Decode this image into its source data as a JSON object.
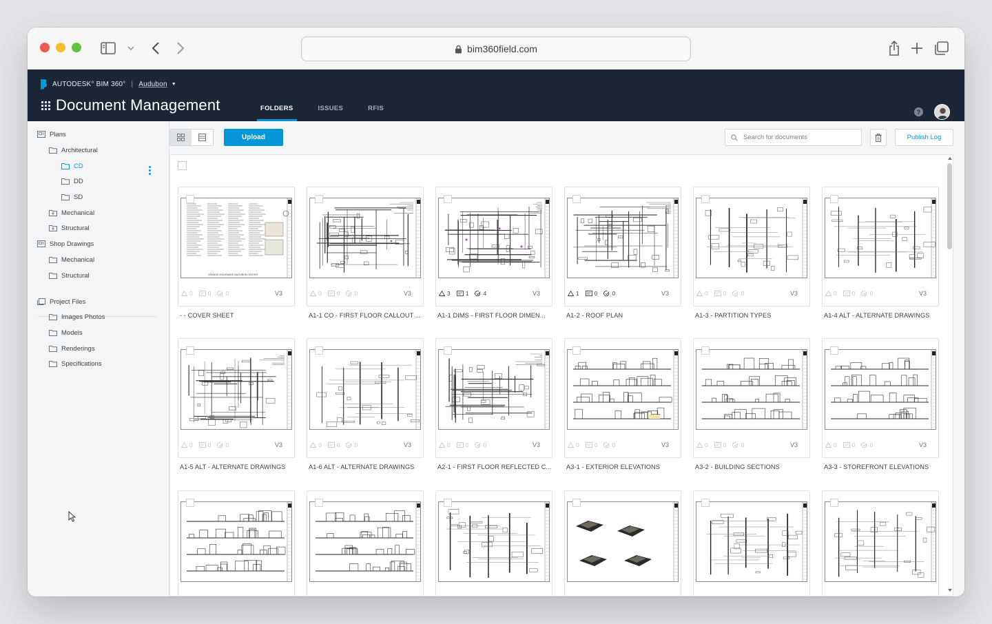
{
  "browser": {
    "url": "bim360field.com"
  },
  "header": {
    "brand": "AUTODESK° BIM 360°",
    "project": "Audubon",
    "title": "Document Management",
    "tabs": [
      {
        "label": "FOLDERS",
        "active": true
      },
      {
        "label": "ISSUES",
        "active": false
      },
      {
        "label": "RFIS",
        "active": false
      }
    ]
  },
  "sidebar": {
    "items": [
      {
        "label": "Plans",
        "level": 0,
        "icon": "plans-folder-icon"
      },
      {
        "label": "Architectural",
        "level": 1,
        "icon": "folder-icon"
      },
      {
        "label": "CD",
        "level": 2,
        "icon": "folder-icon",
        "selected": true
      },
      {
        "label": "DD",
        "level": 2,
        "icon": "folder-icon"
      },
      {
        "label": "SD",
        "level": 2,
        "icon": "folder-icon"
      },
      {
        "label": "Mechanical",
        "level": 1,
        "icon": "folder-plus-icon"
      },
      {
        "label": "Structural",
        "level": 1,
        "icon": "folder-plus-icon"
      },
      {
        "label": "Shop Drawings",
        "level": 0,
        "icon": "plans-folder-icon"
      },
      {
        "label": "Mechanical",
        "level": 1,
        "icon": "folder-icon"
      },
      {
        "label": "Structural",
        "level": 1,
        "icon": "folder-icon"
      },
      {
        "label": "Project Files",
        "level": 0,
        "icon": "project-files-icon"
      },
      {
        "label": "Images Photos",
        "level": 1,
        "icon": "folder-icon"
      },
      {
        "label": "Models",
        "level": 1,
        "icon": "folder-icon"
      },
      {
        "label": "Renderings",
        "level": 1,
        "icon": "folder-icon"
      },
      {
        "label": "Specifications",
        "level": 1,
        "icon": "folder-icon"
      }
    ]
  },
  "toolbar": {
    "upload_label": "Upload",
    "search_placeholder": "Search for documents",
    "publish_log_label": "Publish Log"
  },
  "documents": [
    {
      "name": "- - COVER SHEET",
      "issues": "0",
      "markups": "0",
      "rfis": "0",
      "version": "V3",
      "caption": "GRANGE INSURANCE AUDUBON CENTER"
    },
    {
      "name": "A1-1 CO - FIRST FLOOR CALLOUT ...",
      "issues": "0",
      "markups": "0",
      "rfis": "0",
      "version": "V3"
    },
    {
      "name": "A1-1 DIMS - FIRST FLOOR DIMEN...",
      "issues": "3",
      "markups": "1",
      "rfis": "4",
      "version": "V3"
    },
    {
      "name": "A1-2 - ROOF PLAN",
      "issues": "1",
      "markups": "0",
      "rfis": "0",
      "version": "V3"
    },
    {
      "name": "A1-3 - PARTITION TYPES",
      "issues": "0",
      "markups": "0",
      "rfis": "0",
      "version": "V3"
    },
    {
      "name": "A1-4 ALT - ALTERNATE DRAWINGS",
      "issues": "0",
      "markups": "0",
      "rfis": "0",
      "version": "V3"
    },
    {
      "name": "A1-5 ALT - ALTERNATE DRAWINGS",
      "issues": "0",
      "markups": "0",
      "rfis": "0",
      "version": "V3"
    },
    {
      "name": "A1-6 ALT - ALTERNATE DRAWINGS",
      "issues": "0",
      "markups": "0",
      "rfis": "0",
      "version": "V3"
    },
    {
      "name": "A2-1 - FIRST FLOOR REFLECTED C...",
      "issues": "0",
      "markups": "0",
      "rfis": "0",
      "version": "V3"
    },
    {
      "name": "A3-1 - EXTERIOR ELEVATIONS",
      "issues": "0",
      "markups": "0",
      "rfis": "0",
      "version": "V3"
    },
    {
      "name": "A3-2 - BUILDING SECTIONS",
      "issues": "0",
      "markups": "0",
      "rfis": "0",
      "version": "V3"
    },
    {
      "name": "A3-3 - STOREFRONT ELEVATIONS",
      "issues": "0",
      "markups": "0",
      "rfis": "0",
      "version": "V3"
    },
    {
      "name": "",
      "issues": "",
      "markups": "",
      "rfis": "",
      "version": ""
    },
    {
      "name": "",
      "issues": "",
      "markups": "",
      "rfis": "",
      "version": ""
    },
    {
      "name": "",
      "issues": "",
      "markups": "",
      "rfis": "",
      "version": ""
    },
    {
      "name": "",
      "issues": "",
      "markups": "",
      "rfis": "",
      "version": ""
    },
    {
      "name": "",
      "issues": "",
      "markups": "",
      "rfis": "",
      "version": ""
    },
    {
      "name": "",
      "issues": "",
      "markups": "",
      "rfis": "",
      "version": ""
    }
  ],
  "colors": {
    "header_bg": "#1b2637",
    "accent": "#0696d7",
    "sidebar_bg": "#f4f5f7"
  }
}
